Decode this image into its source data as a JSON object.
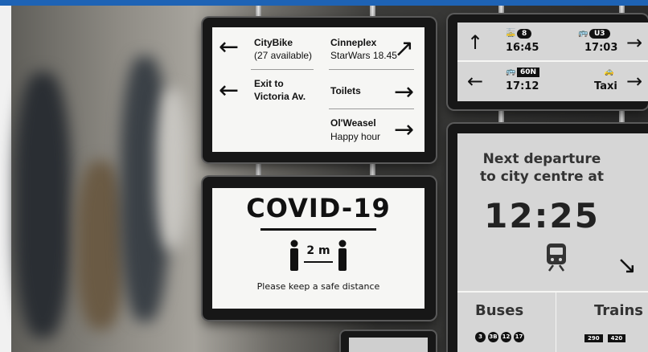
{
  "sign_top": {
    "rows": [
      {
        "left_title": "CityBike",
        "left_sub": "(27 available)",
        "right_title": "Cinneplex",
        "right_sub": "StarWars 18.45",
        "left_arrow": "←",
        "right_arrow": "↗"
      },
      {
        "left_title": "Exit to",
        "left_sub": "Victoria Av.",
        "right_title": "Toilets",
        "right_sub": "",
        "left_arrow": "←",
        "right_arrow": "→"
      },
      {
        "left_title": "",
        "left_sub": "",
        "right_title": "Ol'Weasel",
        "right_sub": "Happy hour",
        "left_arrow": "",
        "right_arrow": "→"
      }
    ]
  },
  "sign_covid": {
    "title": "COVID-19",
    "distance": "2 m",
    "message": "Please keep a safe distance"
  },
  "sign_transit": {
    "row1": {
      "arrow_left": "↑",
      "a_badge": "8",
      "a_time": "16:45",
      "b_badge": "U3",
      "b_time": "17:03",
      "arrow_right": "→"
    },
    "row2": {
      "arrow_left": "←",
      "a_badge": "60N",
      "a_time": "17:12",
      "b_label": "Taxi",
      "arrow_right": "→"
    }
  },
  "sign_departure": {
    "line1": "Next departure",
    "line2": "to city centre at",
    "time": "12:25",
    "arrow": "↘",
    "buses_label": "Buses",
    "trains_label": "Trains",
    "bus_numbers": [
      "3",
      "3B",
      "12",
      "17"
    ],
    "train_numbers": [
      "290",
      "420"
    ]
  },
  "colors": {
    "top_bar": "#1e63b5",
    "sign_bg": "#f6f6f4",
    "sign_grey": "#d6d6d6"
  }
}
